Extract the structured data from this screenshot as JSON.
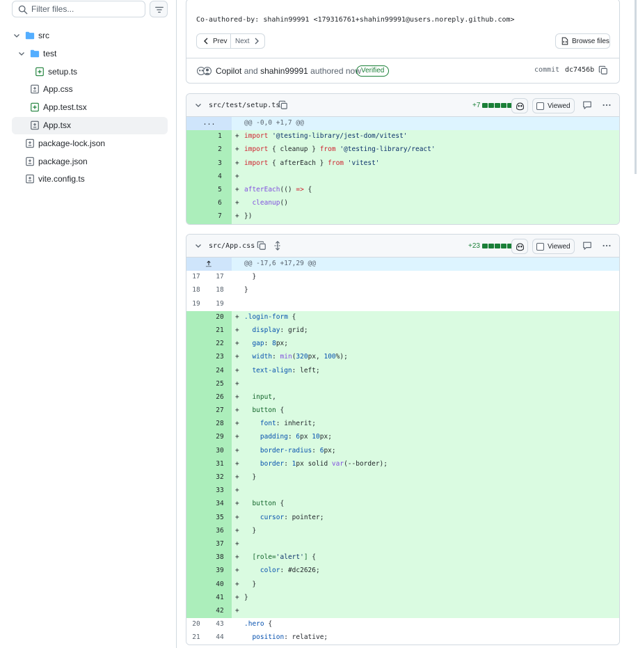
{
  "sidebar": {
    "filter_placeholder": "Filter files...",
    "tree": [
      {
        "label": "src",
        "type": "folder",
        "expanded": true,
        "depth": 0
      },
      {
        "label": "test",
        "type": "folder",
        "expanded": true,
        "depth": 1
      },
      {
        "label": "setup.ts",
        "type": "file-added",
        "depth": 2
      },
      {
        "label": "App.css",
        "type": "file-modified",
        "depth": 1
      },
      {
        "label": "App.test.tsx",
        "type": "file-added",
        "depth": 1
      },
      {
        "label": "App.tsx",
        "type": "file-modified",
        "depth": 1,
        "selected": true
      },
      {
        "label": "package-lock.json",
        "type": "file-modified",
        "depth": 0
      },
      {
        "label": "package.json",
        "type": "file-modified",
        "depth": 0
      },
      {
        "label": "vite.config.ts",
        "type": "file-modified",
        "depth": 0
      }
    ]
  },
  "commit": {
    "coauthored": "Co-authored-by: shahin99991 <179316761+shahin99991@users.noreply.github.com>",
    "prev_label": "Prev",
    "next_label": "Next",
    "browse_label": "Browse files",
    "author_copilot": "Copilot",
    "author_and": "and",
    "author_user": "shahin99991",
    "authored_text": "authored now",
    "verified_label": "Verified",
    "commit_word": "commit",
    "sha": "dc7456b"
  },
  "files": [
    {
      "name": "src/test/setup.ts",
      "additions": "+7",
      "viewed_label": "Viewed",
      "hunk_header": "@@ -0,0 +1,7 @@",
      "hunk_glyph": "...",
      "lines": [
        {
          "type": "add",
          "old": "",
          "new": "1",
          "text": "import '@testing-library/jest-dom/vitest'"
        },
        {
          "type": "add",
          "old": "",
          "new": "2",
          "text": "import { cleanup } from '@testing-library/react'"
        },
        {
          "type": "add",
          "old": "",
          "new": "3",
          "text": "import { afterEach } from 'vitest'"
        },
        {
          "type": "add",
          "old": "",
          "new": "4",
          "text": ""
        },
        {
          "type": "add",
          "old": "",
          "new": "5",
          "text": "afterEach(() => {"
        },
        {
          "type": "add",
          "old": "",
          "new": "6",
          "text": "  cleanup()"
        },
        {
          "type": "add",
          "old": "",
          "new": "7",
          "text": "})"
        }
      ]
    },
    {
      "name": "src/App.css",
      "additions": "+23",
      "viewed_label": "Viewed",
      "hunk_header": "@@ -17,6 +17,29 @@",
      "hunk_glyph": "expand-up",
      "lines": [
        {
          "type": "ctx",
          "old": "17",
          "new": "17",
          "text": "  }"
        },
        {
          "type": "ctx",
          "old": "18",
          "new": "18",
          "text": "}"
        },
        {
          "type": "ctx",
          "old": "19",
          "new": "19",
          "text": ""
        },
        {
          "type": "add",
          "old": "",
          "new": "20",
          "text": ".login-form {"
        },
        {
          "type": "add",
          "old": "",
          "new": "21",
          "text": "  display: grid;"
        },
        {
          "type": "add",
          "old": "",
          "new": "22",
          "text": "  gap: 8px;"
        },
        {
          "type": "add",
          "old": "",
          "new": "23",
          "text": "  width: min(320px, 100%);"
        },
        {
          "type": "add",
          "old": "",
          "new": "24",
          "text": "  text-align: left;"
        },
        {
          "type": "add",
          "old": "",
          "new": "25",
          "text": ""
        },
        {
          "type": "add",
          "old": "",
          "new": "26",
          "text": "  input,"
        },
        {
          "type": "add",
          "old": "",
          "new": "27",
          "text": "  button {"
        },
        {
          "type": "add",
          "old": "",
          "new": "28",
          "text": "    font: inherit;"
        },
        {
          "type": "add",
          "old": "",
          "new": "29",
          "text": "    padding: 6px 10px;"
        },
        {
          "type": "add",
          "old": "",
          "new": "30",
          "text": "    border-radius: 6px;"
        },
        {
          "type": "add",
          "old": "",
          "new": "31",
          "text": "    border: 1px solid var(--border);"
        },
        {
          "type": "add",
          "old": "",
          "new": "32",
          "text": "  }"
        },
        {
          "type": "add",
          "old": "",
          "new": "33",
          "text": ""
        },
        {
          "type": "add",
          "old": "",
          "new": "34",
          "text": "  button {"
        },
        {
          "type": "add",
          "old": "",
          "new": "35",
          "text": "    cursor: pointer;"
        },
        {
          "type": "add",
          "old": "",
          "new": "36",
          "text": "  }"
        },
        {
          "type": "add",
          "old": "",
          "new": "37",
          "text": ""
        },
        {
          "type": "add",
          "old": "",
          "new": "38",
          "text": "  [role='alert'] {"
        },
        {
          "type": "add",
          "old": "",
          "new": "39",
          "text": "    color: #dc2626;"
        },
        {
          "type": "add",
          "old": "",
          "new": "40",
          "text": "  }"
        },
        {
          "type": "add",
          "old": "",
          "new": "41",
          "text": "}"
        },
        {
          "type": "add",
          "old": "",
          "new": "42",
          "text": ""
        },
        {
          "type": "ctx",
          "old": "20",
          "new": "43",
          "text": ".hero {"
        },
        {
          "type": "ctx",
          "old": "21",
          "new": "44",
          "text": "  position: relative;"
        }
      ]
    }
  ],
  "colors": {
    "accent_green": "#1a7f37",
    "add_bg": "#dafbe1",
    "add_gutter": "#aceebb",
    "hunk_bg": "#ddf4ff",
    "border": "#d1d9e0"
  }
}
